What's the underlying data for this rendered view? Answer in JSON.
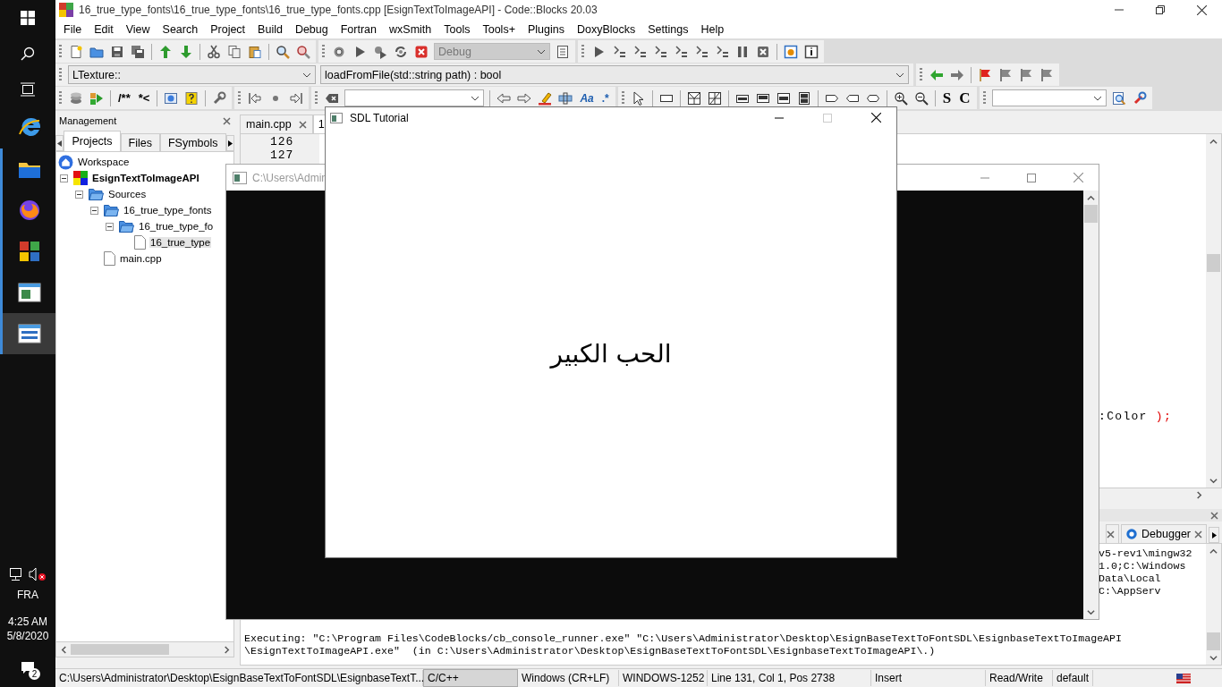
{
  "taskbar": {
    "apps": [
      {
        "kind": "browser",
        "running": false,
        "selected": false
      },
      {
        "kind": "folder",
        "running": true,
        "selected": false
      },
      {
        "kind": "firefox",
        "running": true,
        "selected": false
      },
      {
        "kind": "codeblocks",
        "running": true,
        "selected": false
      },
      {
        "kind": "console",
        "running": true,
        "selected": false
      },
      {
        "kind": "sdl",
        "running": true,
        "selected": true
      }
    ],
    "tray": {
      "volume_muted": true,
      "language": "FRA",
      "time": "4:25 AM",
      "date": "5/8/2020",
      "notifications": "2"
    }
  },
  "window": {
    "title": "16_true_type_fonts\\16_true_type_fonts\\16_true_type_fonts.cpp [EsignTextToImageAPI] - Code::Blocks 20.03",
    "menu": [
      "File",
      "Edit",
      "View",
      "Search",
      "Project",
      "Build",
      "Debug",
      "Fortran",
      "wxSmith",
      "Tools",
      "Tools+",
      "Plugins",
      "DoxyBlocks",
      "Settings",
      "Help"
    ]
  },
  "toolbar": {
    "build_target": {
      "value": "Debug",
      "disabled": true
    },
    "scope": "LTexture::",
    "function": "loadFromFile(std::string path) : bool",
    "doxy_buttons": [
      "/**",
      "*<"
    ],
    "regex_buttons": [
      "Aa",
      ".*"
    ],
    "letter_buttons": [
      "S",
      "C"
    ]
  },
  "management": {
    "title": "Management",
    "tabs": [
      {
        "label": "Projects",
        "selected": true
      },
      {
        "label": "Files",
        "selected": false
      },
      {
        "label": "FSymbols",
        "selected": false
      }
    ],
    "tree": [
      {
        "label": "Workspace",
        "kind": "workspace",
        "selected": false,
        "children": [
          {
            "label": "EsignTextToImageAPI",
            "kind": "project",
            "expanded": true,
            "selected": false,
            "children": [
              {
                "label": "Sources",
                "kind": "folder",
                "expanded": true,
                "selected": false,
                "children": [
                  {
                    "label": "16_true_type_fonts",
                    "kind": "folder",
                    "expanded": true,
                    "selected": false,
                    "children": [
                      {
                        "label": "16_true_type_fo",
                        "kind": "folder",
                        "expanded": true,
                        "selected": false,
                        "children": [
                          {
                            "label": "16_true_type",
                            "kind": "file",
                            "selected": true
                          }
                        ]
                      }
                    ]
                  },
                  {
                    "label": "main.cpp",
                    "kind": "file",
                    "selected": false
                  }
                ]
              }
            ]
          }
        ]
      }
    ]
  },
  "editor": {
    "tabs": [
      {
        "label": "main.cpp",
        "selected": false
      },
      {
        "label": "1",
        "selected": true
      }
    ],
    "line_numbers": [
      "126",
      "127"
    ],
    "code": [
      {
        "text": ":Color",
        "kind": "identifier"
      },
      {
        "text": " );",
        "kind": "operator"
      }
    ]
  },
  "log": {
    "tabs": [
      {
        "label": "Debugger"
      }
    ],
    "fragments": [
      "v5-rev1\\mingw32",
      "1.0;C:\\Windows",
      "Data\\Local",
      "C:\\AppServ"
    ],
    "lines": [
      "Executing: \"C:\\Program Files\\CodeBlocks/cb_console_runner.exe\" \"C:\\Users\\Administrator\\Desktop\\EsignBaseTextToFontSDL\\EsignbaseTextToImageAPI",
      "\\EsignTextToImageAPI.exe\"  (in C:\\Users\\Administrator\\Desktop\\EsignBaseTextToFontSDL\\EsignbaseTextToImageAPI\\.)"
    ]
  },
  "status_bar": [
    {
      "text": "C:\\Users\\Administrator\\Desktop\\EsignBaseTextToFontSDL\\EsignbaseTextT...",
      "highlighted": false
    },
    {
      "text": "C/C++",
      "highlighted": true
    },
    {
      "text": "Windows (CR+LF)",
      "highlighted": false
    },
    {
      "text": "WINDOWS-1252",
      "highlighted": false
    },
    {
      "text": "Line 131, Col 1, Pos 2738",
      "highlighted": false
    },
    {
      "text": "Insert",
      "highlighted": false
    },
    {
      "text": "Read/Write",
      "highlighted": false
    },
    {
      "text": "default",
      "highlighted": false
    }
  ],
  "console_window": {
    "title": "C:\\Users\\Admin",
    "active": false
  },
  "sdl_window": {
    "title": "SDL Tutorial",
    "text": "الحب الكبير",
    "maximize_disabled": true
  }
}
